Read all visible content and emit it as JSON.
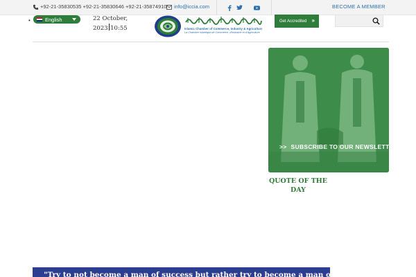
{
  "topbar": {
    "phones": "+92-21-35830535 +92-21-35830646 +92-21-35874910",
    "email": "info@iccia.com",
    "social": [
      "facebook-icon",
      "twitter-icon",
      "youtube-icon"
    ],
    "member_link": "BECOME A MEMBER"
  },
  "header": {
    "language": "English",
    "date_line1": "22 October,",
    "date_year": "2023",
    "date_time": "10:55",
    "logo": {
      "arabic": "الغرفة الإسلامية للتجارة والصناعة والزراعة",
      "english": "Islamic Chamber of Commerce, Industry & Agriculture",
      "french": "La Chambre Islamique de Commerce, d'Industrie et d'Agriculture"
    },
    "accredited_button": "Get Accredited",
    "search_placeholder": ""
  },
  "card": {
    "subscribe": "SUBSCRIBE TO OUR NEWSLETTER"
  },
  "quote_of_day": {
    "title_line1": "QUOTE OF THE",
    "title_line2": "DAY"
  },
  "quote": {
    "text": "\"Try to not become a man of success but rather try to become a man of value.\""
  },
  "colors": {
    "brand_green": "#2f7d3a",
    "link_blue": "#2e6fb0",
    "quote_navy": "#2c3e8f"
  }
}
